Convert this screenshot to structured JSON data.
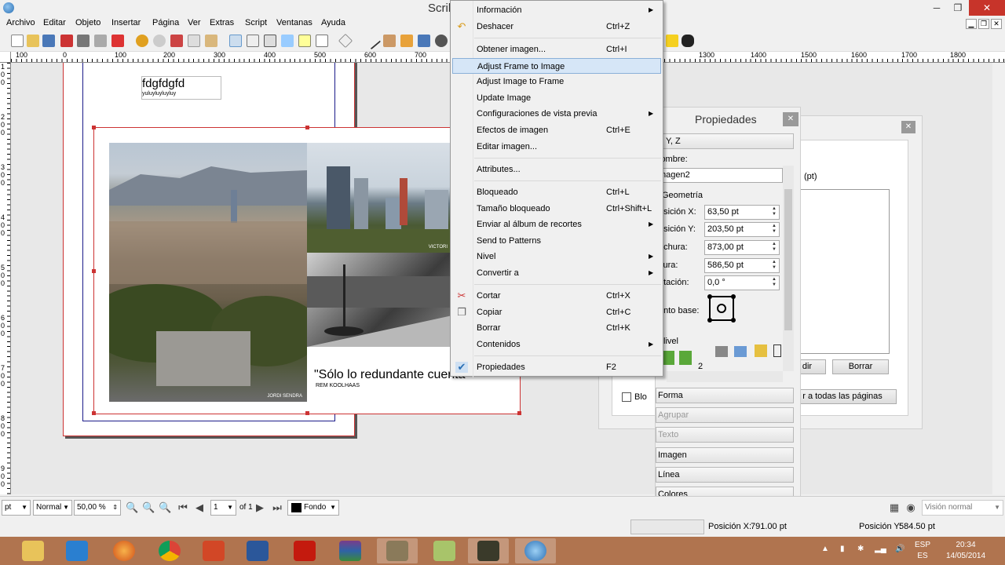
{
  "window": {
    "title": "Scrib",
    "controls": [
      "─",
      "❐",
      "✕"
    ]
  },
  "menubar": [
    "Archivo",
    "Editar",
    "Objeto",
    "Insertar",
    "Página",
    "Ver",
    "Extras",
    "Script",
    "Ventanas",
    "Ayuda"
  ],
  "ruler": {
    "h_labels": [
      "100",
      "0",
      "100",
      "200",
      "300",
      "400",
      "500",
      "600",
      "700",
      "1300",
      "1400",
      "1500",
      "1600",
      "1700",
      "1800"
    ],
    "v_labels": [
      "1",
      "0",
      "0",
      "2",
      "0",
      "0",
      "3",
      "0",
      "0",
      "4",
      "0",
      "0",
      "5",
      "0",
      "0",
      "6",
      "0",
      "0",
      "7",
      "0",
      "0",
      "8",
      "0",
      "0",
      "9",
      "0",
      "0"
    ]
  },
  "canvas": {
    "text_frame": {
      "title": "fdgfdgfd",
      "subtitle": "yuluyluyluyluy"
    },
    "photo_credit_left": "JORDI SENDRA",
    "photo_credit_right": "VICTORI",
    "quote": "\"Sólo lo redundante cuenta\"",
    "quote_author": "REM KOOLHAAS"
  },
  "context_menu": {
    "items": [
      {
        "label": "Información",
        "shortcut": "",
        "submenu": true,
        "icon": ""
      },
      {
        "label": "Deshacer",
        "shortcut": "Ctrl+Z",
        "submenu": false,
        "icon": "undo-icon"
      },
      {
        "label": "Obtener imagen...",
        "shortcut": "Ctrl+I",
        "submenu": false,
        "icon": ""
      },
      {
        "label": "Adjust Frame to Image",
        "shortcut": "",
        "submenu": false,
        "icon": "",
        "highlighted": true
      },
      {
        "label": "Adjust Image to Frame",
        "shortcut": "",
        "submenu": false,
        "icon": ""
      },
      {
        "label": "Update Image",
        "shortcut": "",
        "submenu": false,
        "icon": ""
      },
      {
        "label": "Configuraciones de vista previa",
        "shortcut": "",
        "submenu": true,
        "icon": ""
      },
      {
        "label": "Efectos de imagen",
        "shortcut": "Ctrl+E",
        "submenu": false,
        "icon": ""
      },
      {
        "label": "Editar imagen...",
        "shortcut": "",
        "submenu": false,
        "icon": ""
      },
      {
        "label": "Attributes...",
        "shortcut": "",
        "submenu": false,
        "icon": ""
      },
      {
        "label": "Bloqueado",
        "shortcut": "Ctrl+L",
        "submenu": false,
        "icon": ""
      },
      {
        "label": "Tamaño bloqueado",
        "shortcut": "Ctrl+Shift+L",
        "submenu": false,
        "icon": ""
      },
      {
        "label": "Enviar al álbum de recortes",
        "shortcut": "",
        "submenu": true,
        "icon": ""
      },
      {
        "label": "Send to Patterns",
        "shortcut": "",
        "submenu": false,
        "icon": ""
      },
      {
        "label": "Nivel",
        "shortcut": "",
        "submenu": true,
        "icon": ""
      },
      {
        "label": "Convertir a",
        "shortcut": "",
        "submenu": true,
        "icon": ""
      },
      {
        "label": "Cortar",
        "shortcut": "Ctrl+X",
        "submenu": false,
        "icon": "scissors-icon"
      },
      {
        "label": "Copiar",
        "shortcut": "Ctrl+C",
        "submenu": false,
        "icon": "copy-icon"
      },
      {
        "label": "Borrar",
        "shortcut": "Ctrl+K",
        "submenu": false,
        "icon": ""
      },
      {
        "label": "Contenidos",
        "shortcut": "",
        "submenu": true,
        "icon": ""
      },
      {
        "label": "Propiedades",
        "shortcut": "F2",
        "submenu": false,
        "icon": "check-icon"
      }
    ]
  },
  "properties": {
    "title": "Propiedades",
    "tab_xyz": "Y, Z",
    "name_label": "lombre:",
    "name_value": "magen2",
    "geometry_label": "Geometría",
    "pos_x_label": "osición X:",
    "pos_x_value": "63,50 pt",
    "pos_y_label": "osición Y:",
    "pos_y_value": "203,50 pt",
    "width_label": "nchura:",
    "width_value": "873,00 pt",
    "height_label": "ltura:",
    "height_value": "586,50 pt",
    "rotation_label": "otación:",
    "rotation_value": "0,0 °",
    "basepoint_label": "unto base:",
    "level_label": "livel",
    "level_value": "2",
    "sections": [
      "Forma",
      "Agrupar",
      "Texto",
      "Imagen",
      "Línea",
      "Colores"
    ]
  },
  "back_dialog": {
    "pt_label": "(pt)",
    "btn_edit": "dir",
    "btn_delete": "Borrar",
    "btn_all_pages": "r a todas las páginas",
    "checkbox_label": "Blo"
  },
  "statusbar": {
    "unit": "pt",
    "mode": "Normal",
    "zoom": "50,00 %",
    "page": "1",
    "of_pages": "of 1",
    "layer": "Fondo",
    "view_mode": "Visión normal"
  },
  "coords": {
    "x_label": "Posición X:",
    "x_value": "791.00 pt",
    "y_label": "Posición Y:",
    "y_value": "584.50 pt"
  },
  "taskbar": {
    "lang": "ESP",
    "lang2": "ES",
    "time": "20:34",
    "date": "14/05/2014",
    "apps": [
      "file-explorer-icon",
      "blender-icon",
      "firefox-icon",
      "chrome-icon",
      "powerpoint-icon",
      "word-icon",
      "acrobat-icon",
      "winrar-icon",
      "gimp-icon",
      "scribus-doc-icon",
      "camera-icon",
      "scribus-icon"
    ]
  },
  "colors": {
    "frame_red": "#cc3333",
    "margin_blue": "#1b1b8a",
    "highlight": "#d6e6f7",
    "taskbar": "#b0744f"
  }
}
